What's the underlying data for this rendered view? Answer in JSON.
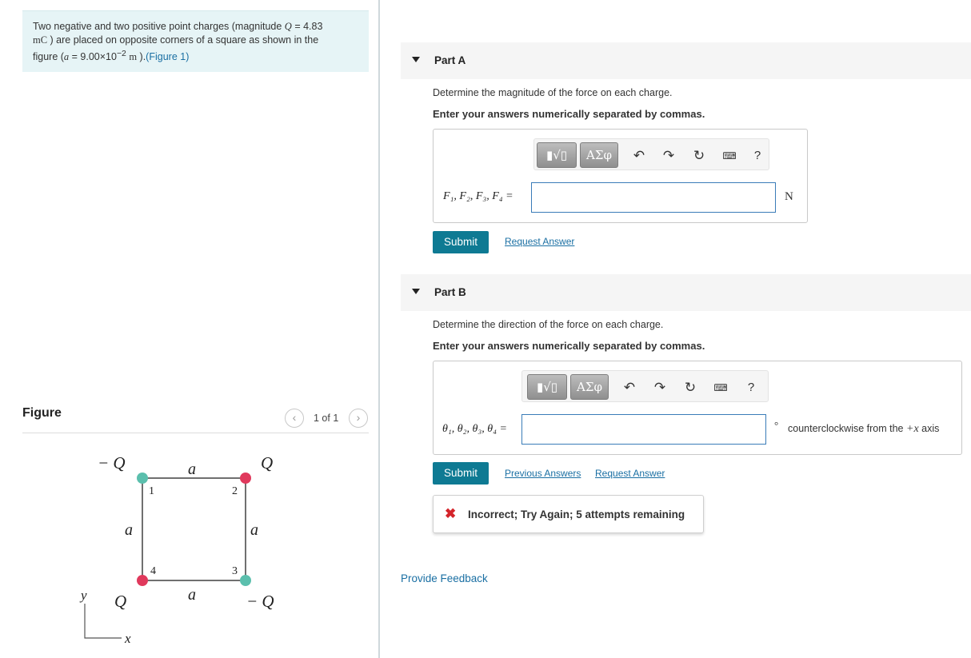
{
  "problem": {
    "text_1": "Two negative and two positive point charges (magnitude",
    "q_symbol": "Q",
    "text_2": "= 4.83",
    "unit_mc": "mC",
    "text_3": ") are placed on opposite corners of a square as shown in the",
    "text_4": "figure (",
    "a_symbol": "a",
    "text_5": "= 9.00×10",
    "exponent": "−2",
    "unit_m": "m",
    "text_6": ").",
    "figure_link": "(Figure 1)"
  },
  "figure_panel": {
    "header": "Figure",
    "pager_text": "1 of 1",
    "prev_icon": "chevron-left-icon",
    "next_icon": "chevron-right-icon",
    "labels": {
      "charge_1": "− Q",
      "charge_2": "Q",
      "charge_3": "− Q",
      "charge_4": "Q",
      "side_top": "a",
      "side_left": "a",
      "side_right": "a",
      "side_bottom": "a",
      "corner_1": "1",
      "corner_2": "2",
      "corner_3": "3",
      "corner_4": "4",
      "axis_y": "y",
      "axis_x": "x"
    },
    "colors": {
      "negative": "#5bbfad",
      "positive": "#e0395c"
    }
  },
  "part_a": {
    "title": "Part A",
    "prompt": "Determine the magnitude of the force on each charge.",
    "instruction": "Enter your answers numerically separated by commas.",
    "answer_label": "F₁, F₂, F₃, F₄ =",
    "answer_value": "",
    "unit": "N",
    "submit_label": "Submit",
    "request_answer": "Request Answer"
  },
  "part_b": {
    "title": "Part B",
    "prompt": "Determine the direction of the force on each charge.",
    "instruction": "Enter your answers numerically separated by commas.",
    "answer_label": "θ₁, θ₂, θ₃, θ₄ =",
    "answer_value": "",
    "unit_degree": "°",
    "unit_text_1": "counterclockwise from the",
    "unit_math": "+x",
    "unit_text_2": "axis",
    "submit_label": "Submit",
    "previous_answers": "Previous Answers",
    "request_answer": "Request Answer",
    "feedback_icon": "x-icon",
    "feedback_text": "Incorrect; Try Again; 5 attempts remaining"
  },
  "toolbar": {
    "templates_label": "▮√▯",
    "symbols_label": "ΑΣφ",
    "undo_icon": "undo-icon",
    "redo_icon": "redo-icon",
    "reset_icon": "reset-icon",
    "keyboard_icon": "keyboard-icon",
    "help_label": "?"
  },
  "footer": {
    "provide_feedback": "Provide Feedback"
  }
}
